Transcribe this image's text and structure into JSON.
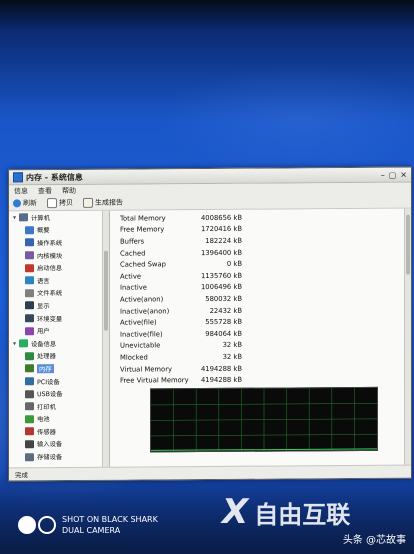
{
  "window": {
    "title": "内存 - 系统信息",
    "controls": [
      "–",
      "▢",
      "✕"
    ],
    "menu": [
      "信息",
      "查看",
      "帮助"
    ],
    "toolbar": {
      "refresh": "刷新",
      "copy": "拷贝",
      "report": "生成报告"
    },
    "status": "完成"
  },
  "tree": [
    {
      "label": "计算机",
      "level": 0,
      "expander": "▾",
      "icon_color": "#5a6a8a",
      "icon": "computer-icon"
    },
    {
      "label": "概要",
      "level": 1,
      "icon_color": "#3b78c8",
      "icon": "info-icon"
    },
    {
      "label": "操作系统",
      "level": 1,
      "icon_color": "#3766b0",
      "icon": "os-icon"
    },
    {
      "label": "内核模块",
      "level": 1,
      "icon_color": "#7a5aa0",
      "icon": "kernel-module-icon"
    },
    {
      "label": "启动信息",
      "level": 1,
      "icon_color": "#c0392b",
      "icon": "boot-icon"
    },
    {
      "label": "语言",
      "level": 1,
      "icon_color": "#2e86c1",
      "icon": "language-icon"
    },
    {
      "label": "文件系统",
      "level": 1,
      "icon_color": "#808080",
      "icon": "filesystem-icon"
    },
    {
      "label": "显示",
      "level": 1,
      "icon_color": "#2c3e50",
      "icon": "display-icon"
    },
    {
      "label": "环境变量",
      "level": 1,
      "icon_color": "#34495e",
      "icon": "environment-icon"
    },
    {
      "label": "用户",
      "level": 1,
      "icon_color": "#8e44ad",
      "icon": "users-icon"
    },
    {
      "label": "设备信息",
      "level": 0,
      "expander": "▾",
      "icon_color": "#27ae60",
      "icon": "devices-icon"
    },
    {
      "label": "处理器",
      "level": 1,
      "icon_color": "#2d8a3e",
      "icon": "cpu-icon"
    },
    {
      "label": "内存",
      "level": 1,
      "selected": true,
      "icon_color": "#3f7a2f",
      "icon": "memory-icon"
    },
    {
      "label": "PCI设备",
      "level": 1,
      "icon_color": "#2f6f9f",
      "icon": "pci-icon"
    },
    {
      "label": "USB设备",
      "level": 1,
      "icon_color": "#555555",
      "icon": "usb-icon"
    },
    {
      "label": "打印机",
      "level": 1,
      "icon_color": "#666666",
      "icon": "printer-icon"
    },
    {
      "label": "电池",
      "level": 1,
      "icon_color": "#3a9a3a",
      "icon": "battery-icon"
    },
    {
      "label": "传感器",
      "level": 1,
      "icon_color": "#b03a2e",
      "icon": "sensor-icon"
    },
    {
      "label": "输入设备",
      "level": 1,
      "icon_color": "#444444",
      "icon": "input-device-icon"
    },
    {
      "label": "存储设备",
      "level": 1,
      "icon_color": "#5d6d7e",
      "icon": "storage-icon"
    }
  ],
  "memory": [
    {
      "label": "Total Memory",
      "value": "4008656 kB"
    },
    {
      "label": "Free Memory",
      "value": "1720416 kB"
    },
    {
      "label": "Buffers",
      "value": "182224 kB"
    },
    {
      "label": "Cached",
      "value": "1396400 kB"
    },
    {
      "label": "Cached Swap",
      "value": "0 kB"
    },
    {
      "label": "Active",
      "value": "1135760 kB"
    },
    {
      "label": "Inactive",
      "value": "1006496 kB"
    },
    {
      "label": "Active(anon)",
      "value": "580032 kB"
    },
    {
      "label": "Inactive(anon)",
      "value": "22432 kB"
    },
    {
      "label": "Active(file)",
      "value": "555728 kB"
    },
    {
      "label": "Inactive(file)",
      "value": "984064 kB"
    },
    {
      "label": "Unevictable",
      "value": "32 kB"
    },
    {
      "label": "Mlocked",
      "value": "32 kB"
    },
    {
      "label": "Virtual Memory",
      "value": "4194288 kB"
    },
    {
      "label": "Free Virtual Memory",
      "value": "4194288 kB"
    }
  ],
  "graph": {
    "background": "#0a0a0a",
    "grid_color": "#1f6f2a",
    "line_color": "#35d05a"
  },
  "photo_overlay": {
    "camera_line1": "SHOT ON BLACK SHARK",
    "camera_line2": "DUAL CAMERA",
    "watermark": "自由互联",
    "source": "头条 @芯故事"
  }
}
